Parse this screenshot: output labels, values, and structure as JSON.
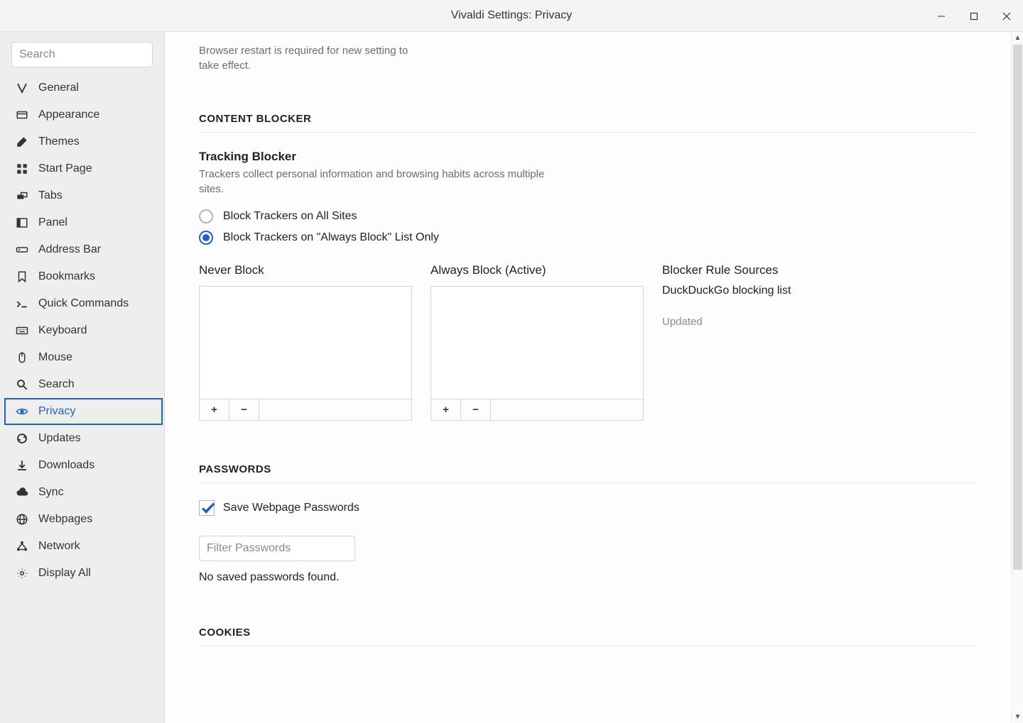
{
  "window": {
    "title": "Vivaldi Settings: Privacy"
  },
  "search": {
    "placeholder": "Search"
  },
  "sidebar": {
    "items": [
      {
        "label": "General",
        "icon": "vivaldi"
      },
      {
        "label": "Appearance",
        "icon": "appearance"
      },
      {
        "label": "Themes",
        "icon": "brush"
      },
      {
        "label": "Start Page",
        "icon": "grid"
      },
      {
        "label": "Tabs",
        "icon": "tabs"
      },
      {
        "label": "Panel",
        "icon": "panel"
      },
      {
        "label": "Address Bar",
        "icon": "addressbar"
      },
      {
        "label": "Bookmarks",
        "icon": "bookmark"
      },
      {
        "label": "Quick Commands",
        "icon": "quick"
      },
      {
        "label": "Keyboard",
        "icon": "keyboard"
      },
      {
        "label": "Mouse",
        "icon": "mouse"
      },
      {
        "label": "Search",
        "icon": "search"
      },
      {
        "label": "Privacy",
        "icon": "eye",
        "active": true
      },
      {
        "label": "Updates",
        "icon": "sync"
      },
      {
        "label": "Downloads",
        "icon": "download"
      },
      {
        "label": "Sync",
        "icon": "cloud"
      },
      {
        "label": "Webpages",
        "icon": "globe"
      },
      {
        "label": "Network",
        "icon": "network"
      },
      {
        "label": "Display All",
        "icon": "gear"
      }
    ]
  },
  "notice": "Browser restart is required for new setting to take effect.",
  "content_blocker": {
    "heading": "CONTENT BLOCKER",
    "tracking": {
      "title": "Tracking Blocker",
      "desc": "Trackers collect personal information and browsing habits across multiple sites.",
      "options": [
        {
          "label": "Block Trackers on All Sites",
          "selected": false
        },
        {
          "label": "Block Trackers on \"Always Block\" List Only",
          "selected": true
        }
      ]
    },
    "never_block": {
      "title": "Never Block"
    },
    "always_block": {
      "title": "Always Block (Active)"
    },
    "rule_sources": {
      "title": "Blocker Rule Sources",
      "source": "DuckDuckGo blocking list",
      "updated": "Updated"
    },
    "add_label": "+",
    "remove_label": "−"
  },
  "passwords": {
    "heading": "PASSWORDS",
    "save_label": "Save Webpage Passwords",
    "save_checked": true,
    "filter_placeholder": "Filter Passwords",
    "none": "No saved passwords found."
  },
  "cookies": {
    "heading": "COOKIES"
  }
}
